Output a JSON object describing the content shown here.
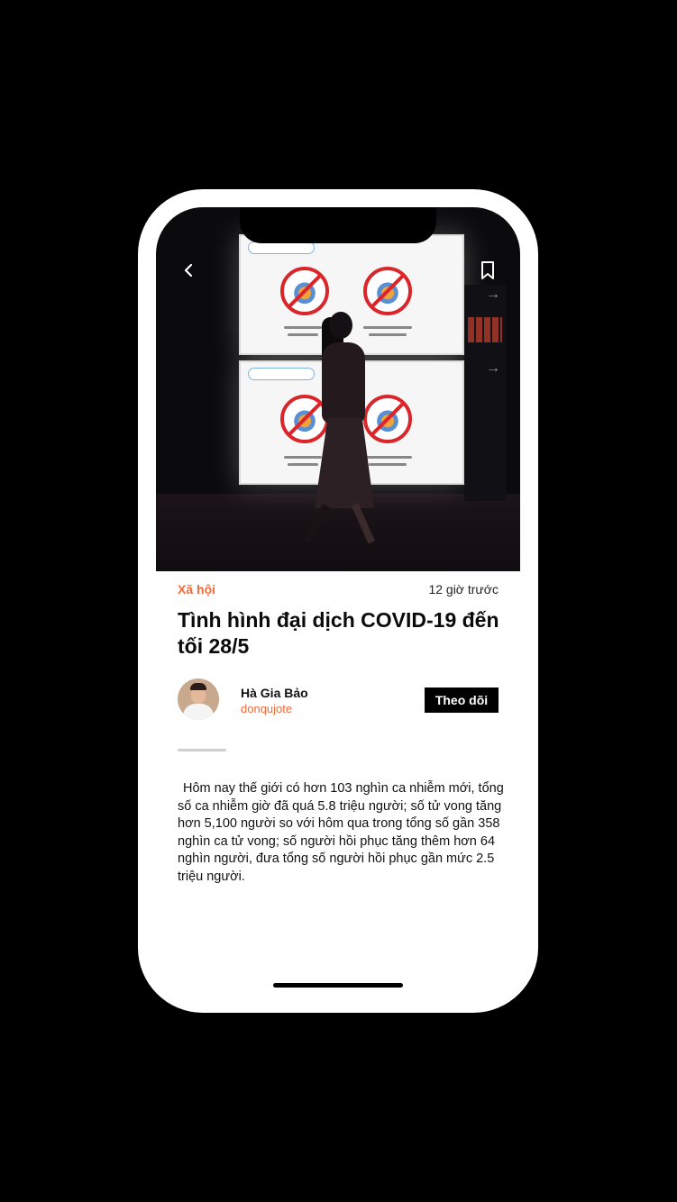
{
  "nav": {
    "back_icon": "chevron-left-icon",
    "bookmark_icon": "bookmark-icon"
  },
  "article": {
    "category": "Xã hội",
    "time_ago": "12 giờ trước",
    "title": "Tình hình đại dịch COVID-19 đến tối 28/5",
    "body": "Hôm nay thế giới có hơn 103 nghìn ca nhiễm mới, tổng số ca nhiễm giờ đã quá 5.8 triệu người; số tử vong tăng hơn 5,100 người so với hôm qua trong tổng số gần 358 nghìn ca tử vong; số người hồi phục tăng thêm hơn 64 nghìn người, đưa tổng số người hồi phục gần mức 2.5 triệu người."
  },
  "author": {
    "name": "Hà Gia Bảo",
    "handle": "donqujote",
    "follow_label": "Theo dõi"
  },
  "colors": {
    "accent": "#f26b3a",
    "background": "#000000",
    "card": "#ffffff",
    "button": "#000000"
  }
}
